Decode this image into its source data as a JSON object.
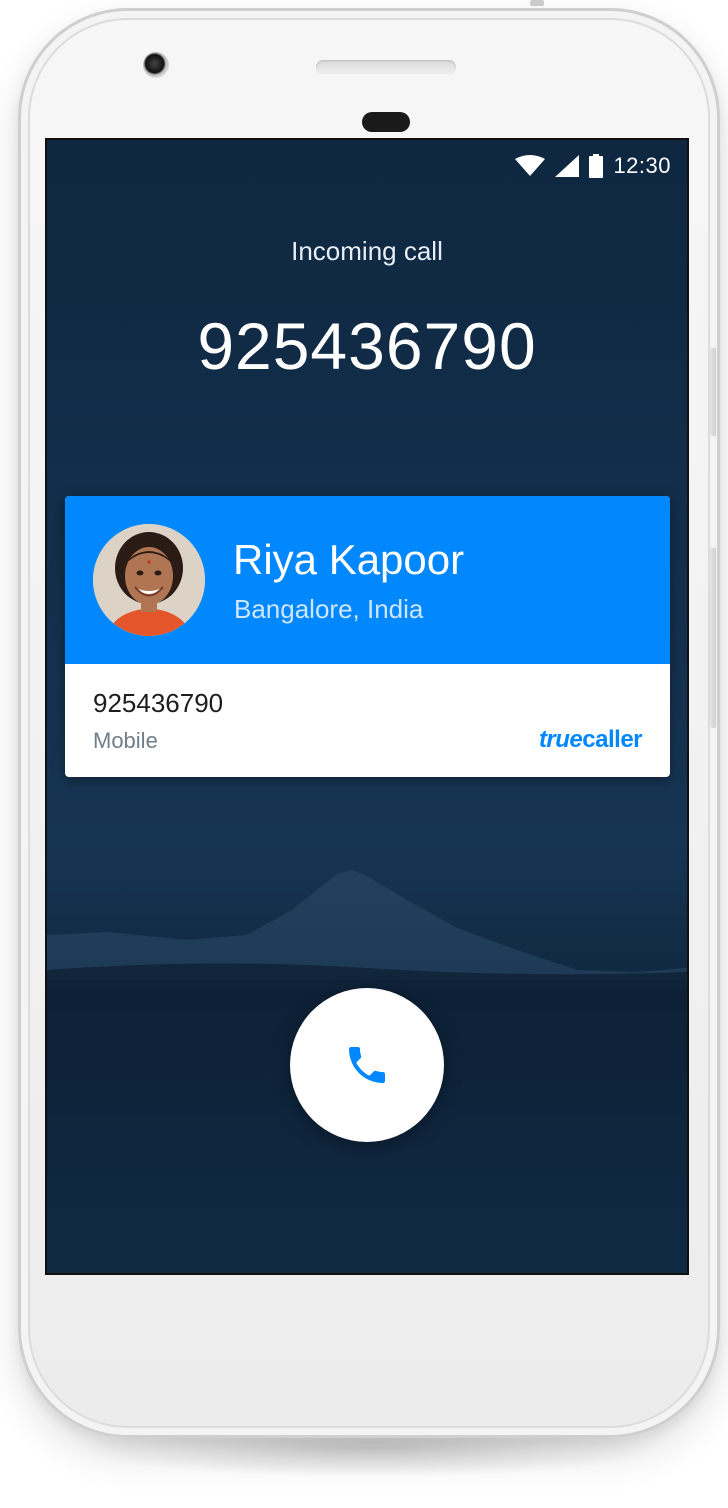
{
  "status_bar": {
    "time": "12:30",
    "icons": [
      "wifi-icon",
      "signal-icon",
      "battery-icon"
    ]
  },
  "call": {
    "label": "Incoming call",
    "number": "925436790"
  },
  "caller_card": {
    "name": "Riya Kapoor",
    "location": "Bangalore, India",
    "number": "925436790",
    "number_type": "Mobile",
    "brand_part1": "true",
    "brand_part2": "caller",
    "accent_color": "#0187fe"
  },
  "answer_button": {
    "icon": "phone-icon",
    "icon_color": "#0187fe"
  }
}
